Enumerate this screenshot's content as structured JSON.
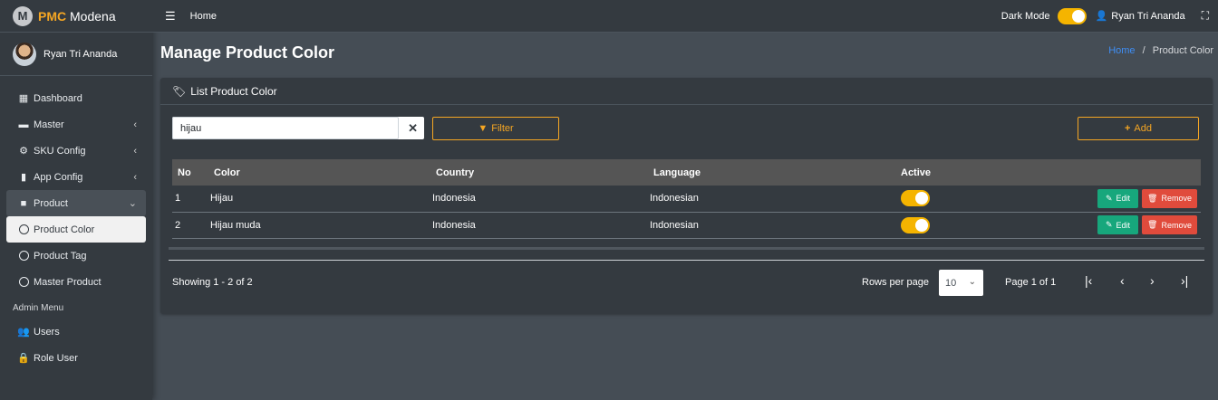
{
  "brand": {
    "prefix": "PMC",
    "suffix": " Modena",
    "logo_letter": "M"
  },
  "user": {
    "name": "Ryan Tri Ananda"
  },
  "sidebar": {
    "items": [
      {
        "label": "Dashboard",
        "icon": "grid-icon"
      },
      {
        "label": "Master",
        "icon": "car-icon"
      },
      {
        "label": "SKU Config",
        "icon": "gear-icon"
      },
      {
        "label": "App Config",
        "icon": "mobile-icon"
      },
      {
        "label": "Product",
        "icon": "briefcase-icon"
      },
      {
        "label": "Product Color",
        "icon": "circle-icon"
      },
      {
        "label": "Product Tag",
        "icon": "circle-icon"
      },
      {
        "label": "Master Product",
        "icon": "circle-icon"
      }
    ],
    "admin_header": "Admin Menu",
    "admin_items": [
      {
        "label": "Users",
        "icon": "users-icon"
      },
      {
        "label": "Role User",
        "icon": "lock-icon"
      }
    ]
  },
  "topbar": {
    "home": "Home",
    "dark_mode_label": "Dark Mode",
    "dark_mode_on": true,
    "user": "Ryan Tri Ananda"
  },
  "page": {
    "title": "Manage Product Color",
    "breadcrumb_home": "Home",
    "breadcrumb_sep": "/",
    "breadcrumb_current": "Product Color"
  },
  "card": {
    "title": "List Product Color"
  },
  "search": {
    "value": "hijau",
    "clear": "✕"
  },
  "filter_label": "Filter",
  "add_label": "Add",
  "table": {
    "headers": {
      "no": "No",
      "color": "Color",
      "country": "Country",
      "language": "Language",
      "active": "Active"
    },
    "rows": [
      {
        "no": "1",
        "color": "Hijau",
        "country": "Indonesia",
        "language": "Indonesian",
        "active": true,
        "edit": "Edit",
        "remove": "Remove"
      },
      {
        "no": "2",
        "color": "Hijau muda",
        "country": "Indonesia",
        "language": "Indonesian",
        "active": true,
        "edit": "Edit",
        "remove": "Remove"
      }
    ]
  },
  "pagination": {
    "showing": "Showing 1 - 2 of 2",
    "rows_per_page_label": "Rows per page",
    "rows_per_page": "10",
    "page_info": "Page 1 of 1"
  },
  "colors": {
    "accent": "#f5a623",
    "toggle": "#f5b400",
    "edit": "#17a77c",
    "remove": "#e04b3c",
    "link": "#3f8ef5"
  }
}
